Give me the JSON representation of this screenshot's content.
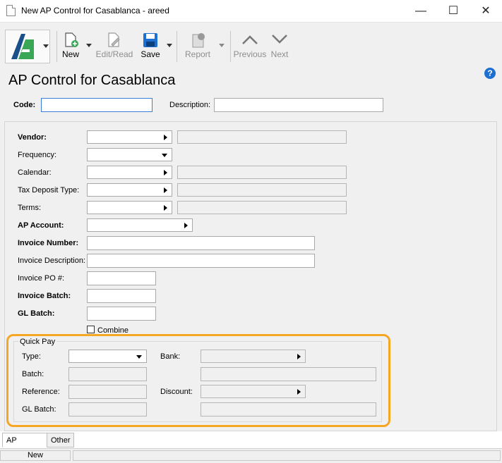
{
  "window": {
    "title": "New AP Control for Casablanca - areed",
    "min_icon": "minimize-icon",
    "max_icon": "maximize-icon",
    "close_icon": "close-icon",
    "min_glyph": "—",
    "max_glyph": "☐",
    "close_glyph": "✕"
  },
  "toolbar": {
    "new_label": "New",
    "edit_read_label": "Edit/Read",
    "save_label": "Save",
    "report_label": "Report",
    "previous_label": "Previous",
    "next_label": "Next"
  },
  "page": {
    "heading": "AP Control for Casablanca",
    "help_glyph": "?"
  },
  "header_fields": {
    "code_label": "Code:",
    "code_value": "",
    "description_label": "Description:",
    "description_value": ""
  },
  "form": {
    "vendor_label": "Vendor:",
    "frequency_label": "Frequency:",
    "calendar_label": "Calendar:",
    "tax_deposit_type_label": "Tax Deposit Type:",
    "terms_label": "Terms:",
    "ap_account_label": "AP Account:",
    "invoice_number_label": "Invoice Number:",
    "invoice_description_label": "Invoice Description:",
    "invoice_po_label": "Invoice PO #:",
    "invoice_batch_label": "Invoice Batch:",
    "gl_batch_label": "GL Batch:",
    "combine_label": "Combine"
  },
  "quick_pay": {
    "group_label": "Quick Pay",
    "type_label": "Type:",
    "bank_label": "Bank:",
    "batch_label": "Batch:",
    "reference_label": "Reference:",
    "discount_label": "Discount:",
    "gl_batch_label": "GL Batch:"
  },
  "tabs": [
    "AP Control",
    "Other"
  ],
  "status": {
    "mode": "New"
  },
  "colors": {
    "highlight": "#f5a623",
    "accent": "#1d6fd1",
    "logo_green": "#3aa757",
    "logo_blue": "#1b4f8a"
  }
}
